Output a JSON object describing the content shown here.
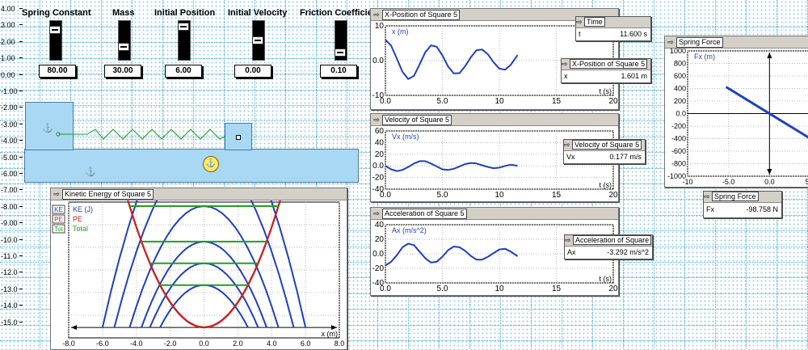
{
  "ruler": [
    "4.00",
    "3.00",
    "2.00",
    "1.00",
    "0.00",
    "-1.00",
    "-2.00",
    "-3.00",
    "-4.00",
    "-5.00",
    "-6.00",
    "-7.00",
    "-8.00",
    "-9.00",
    "-10.0",
    "-11.0",
    "-12.0",
    "-13.0",
    "-14.0",
    "-15.0"
  ],
  "controls": [
    {
      "label": "Spring Constant",
      "value": "80.00",
      "level": 0.85
    },
    {
      "label": "Mass",
      "value": "30.00",
      "level": 0.3
    },
    {
      "label": "Initial Position",
      "value": "6.00",
      "level": 0.95
    },
    {
      "label": "Initial Velocity",
      "value": "0.00",
      "level": 0.5
    },
    {
      "label": "Friction Coefficient",
      "value": "0.10",
      "level": 0.1
    }
  ],
  "readouts": {
    "time": {
      "title": "Time",
      "symbol": "t",
      "value": "11.600 s"
    },
    "xpos": {
      "title": "X-Position of Square 5",
      "symbol": "x",
      "value": "1.601 m"
    },
    "vel": {
      "title": "Velocity of Square 5",
      "symbol": "Vx",
      "value": "0.177 m/s"
    },
    "acc": {
      "title": "Acceleration of Square",
      "symbol": "Ax",
      "value": "-3.292 m/s^2"
    },
    "force": {
      "title": "Spring Force",
      "symbol": "Fx",
      "value": "-98.758 N"
    }
  },
  "chart_data": [
    {
      "type": "line",
      "title": "X-Position of Square 5",
      "ylabel": "x (m)",
      "xlabel": "t (s)",
      "xlim": [
        0,
        20
      ],
      "ylim": [
        -10,
        10
      ],
      "yticks": [
        "10",
        "0.0",
        "-10"
      ],
      "xticks": [
        "0.0",
        "5.0",
        "10",
        "15",
        "20"
      ],
      "series": [
        {
          "x": [
            0,
            0.5,
            1,
            1.5,
            2,
            2.5,
            3,
            3.5,
            4,
            4.5,
            5,
            5.5,
            6,
            6.5,
            7,
            7.5,
            8,
            8.5,
            9,
            9.5,
            10,
            10.5,
            11,
            11.6
          ],
          "values": [
            6.0,
            4.3,
            0.6,
            -3.2,
            -5.3,
            -4.4,
            -1.1,
            2.4,
            4.4,
            4.0,
            1.5,
            -1.7,
            -3.7,
            -3.6,
            -1.6,
            1.0,
            3.0,
            3.2,
            1.8,
            -0.5,
            -2.3,
            -2.6,
            -1.2,
            1.6
          ]
        }
      ]
    },
    {
      "type": "line",
      "title": "Velocity of Square 5",
      "ylabel": "Vx (m/s)",
      "xlabel": "t (s)",
      "xlim": [
        0,
        20
      ],
      "ylim": [
        -40,
        60
      ],
      "yticks": [
        "60",
        "40",
        "20",
        "0.0",
        "-20",
        "-40"
      ],
      "xticks": [
        "0.0",
        "5.0",
        "10",
        "15",
        "20"
      ],
      "series": [
        {
          "x": [
            0,
            0.5,
            1,
            1.5,
            2,
            2.5,
            3,
            3.5,
            4,
            4.5,
            5,
            5.5,
            6,
            6.5,
            7,
            7.5,
            8,
            8.5,
            9,
            9.5,
            10,
            10.5,
            11,
            11.6
          ],
          "values": [
            0,
            -6,
            -9,
            -7,
            -2,
            4,
            8,
            8,
            4,
            -1,
            -6,
            -7,
            -5,
            -1,
            3,
            5,
            4,
            1,
            -2,
            -4,
            -3,
            0,
            2,
            0.2
          ]
        }
      ]
    },
    {
      "type": "line",
      "title": "Acceleration of Square 5",
      "ylabel": "Ax (m/s^2)",
      "xlabel": "t (s)",
      "xlim": [
        0,
        20
      ],
      "ylim": [
        -40,
        40
      ],
      "yticks": [
        "40",
        "20",
        "0.0",
        "-20",
        "-40"
      ],
      "xticks": [
        "0.0",
        "5.0",
        "10",
        "15",
        "20"
      ],
      "series": [
        {
          "x": [
            0,
            0.5,
            1,
            1.5,
            2,
            2.5,
            3,
            3.5,
            4,
            4.5,
            5,
            5.5,
            6,
            6.5,
            7,
            7.5,
            8,
            8.5,
            9,
            9.5,
            10,
            10.5,
            11,
            11.6
          ],
          "values": [
            -16,
            -11,
            -2,
            9,
            14,
            12,
            3,
            -6,
            -12,
            -11,
            -4,
            5,
            10,
            9,
            4,
            -3,
            -8,
            -8,
            -4,
            1,
            6,
            7,
            3,
            -3.3
          ]
        }
      ]
    },
    {
      "type": "line",
      "title": "Spring Force",
      "ylabel": "Fx (m)",
      "xlabel": "",
      "xlim": [
        -10,
        5
      ],
      "ylim": [
        -1000,
        1000
      ],
      "yticks": [
        "1000",
        "800",
        "600",
        "400",
        "200",
        "0.0",
        "-200",
        "-400",
        "-600",
        "-800",
        "-1000"
      ],
      "xticks": [
        "-10",
        "-5.0",
        "0.0",
        "5.0"
      ],
      "series": [
        {
          "x": [
            -5.3,
            6.0
          ],
          "values": [
            424,
            -480
          ]
        }
      ]
    },
    {
      "type": "line",
      "title": "Kinetic Energy of Square 5",
      "xlabel": "x (m)",
      "xlim": [
        -8,
        8
      ],
      "ylim": [
        -10,
        120
      ],
      "xticks": [
        "-8.0",
        "-6.0",
        "-4.0",
        "-2.0",
        "0.0",
        "2.0",
        "4.0",
        "6.0",
        "8.0"
      ],
      "legend": [
        {
          "key": "KE",
          "label": "KE (J)",
          "color": "#1f3fbf"
        },
        {
          "key": "PE",
          "label": "PE",
          "color": "#cc2020"
        },
        {
          "key": "Tot",
          "label": "Total",
          "color": "#20a020"
        }
      ],
      "series": [
        {
          "name": "KE (J)",
          "color": "#1f3fbf",
          "amplitudes": [
            6.0,
            5.3,
            4.4,
            3.7,
            3.2,
            2.6
          ]
        },
        {
          "name": "PE",
          "color": "#cc2020",
          "amplitudes": [
            6.0,
            5.3,
            4.4,
            3.7,
            3.2,
            2.6
          ]
        },
        {
          "name": "Total",
          "color": "#20a020",
          "amplitudes": [
            6.0,
            5.3,
            4.4,
            3.7,
            3.2,
            2.6
          ]
        }
      ]
    }
  ]
}
